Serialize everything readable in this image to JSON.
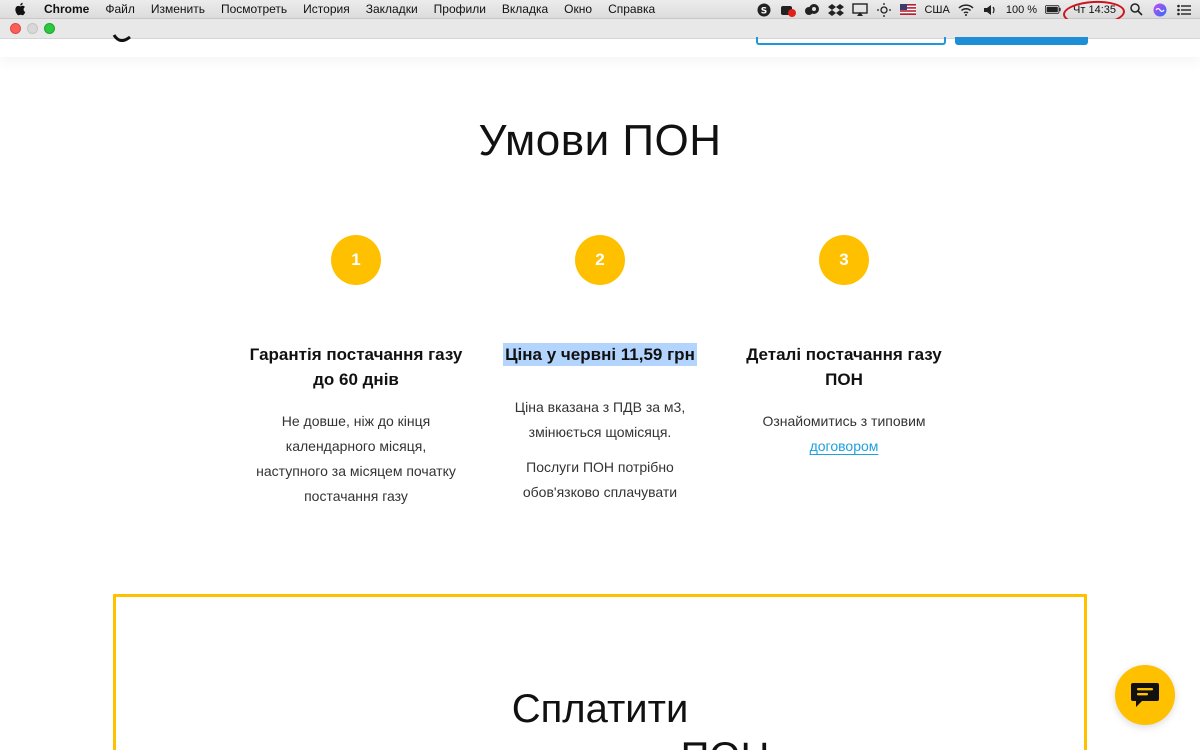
{
  "menubar": {
    "app_name": "Chrome",
    "items": [
      "Файл",
      "Изменить",
      "Посмотреть",
      "История",
      "Закладки",
      "Профили",
      "Вкладка",
      "Окно",
      "Справка"
    ],
    "input_source": "США",
    "battery": "100 %",
    "clock": "Чт 14:35"
  },
  "page": {
    "section_title": "Умови ПОН",
    "steps": [
      "1",
      "2",
      "3"
    ],
    "columns": [
      {
        "title_line1": "Гарантія постачання газу",
        "title_line2": "до 60 днів",
        "text": [
          "Не довше, ніж до кінця",
          "календарного місяця,",
          "наступного за місяцем початку",
          "постачання газу"
        ]
      },
      {
        "title": "Ціна у червні 11,59 грн",
        "para1": [
          "Ціна вказана з ПДВ за м3,",
          "змінюється щомісяця."
        ],
        "para2": [
          "Послуги ПОН потрібно",
          "обов'язково сплачувати"
        ]
      },
      {
        "title_line1": "Деталі постачання газу",
        "title_line2": "ПОН",
        "text": "Ознайомитись з типовим",
        "link": "договором"
      }
    ],
    "pay_title_line1": "Сплатити",
    "pay_title_line2": "ПОН"
  },
  "colors": {
    "accent_yellow": "#ffc000",
    "link_blue": "#1ea0e0",
    "selection": "#b3d4fc",
    "annotation_red": "#d0131b"
  }
}
